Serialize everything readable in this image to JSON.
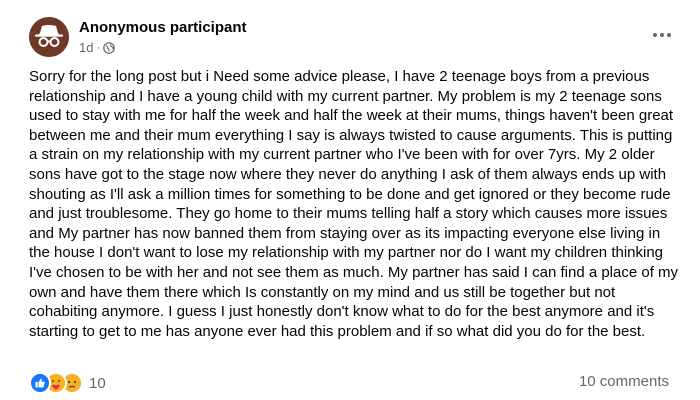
{
  "post": {
    "author": "Anonymous participant",
    "time": "1d",
    "separator": "·",
    "body": "Sorry for the long post but i Need some advice please, I have 2 teenage boys from a previous relationship and I have a young child with my current partner. My problem is my 2 teenage sons used to stay with me for half the week and half the week at their mums, things haven't been great between me and their mum everything I say is always twisted to cause arguments. This is putting a strain on my relationship with my current partner who I've been with for over 7yrs. My 2 older sons have got to the stage now where they never do anything I ask of them always ends up with shouting as I'll ask a million times for something to be done and get ignored or they become rude and just troublesome. They go home to their mums telling half a story which causes more issues and  My partner has now banned them from staying over as its impacting everyone else living in the house I don't want to lose my relationship with my partner nor do I want my children thinking I've chosen to be with her and not see them as much. My partner has said I can find a place of my own and have them there which Is constantly on my mind and us still be together but not cohabiting anymore. I guess I just honestly don't know what to do for the best anymore and it's starting to get to me has anyone ever had this problem and if so what did you do for the best.",
    "reaction_count": "10",
    "comments": "10 comments"
  },
  "icons": {
    "avatar": "anonymous-spy-icon",
    "privacy": "globe-icon",
    "menu": "more-options-icon",
    "reactions": [
      "like-icon",
      "care-icon",
      "sad-icon"
    ]
  },
  "colors": {
    "avatar_bg": "#6e3a27",
    "like_blue": "#1877f2",
    "emoji_yellow": "#f7b125",
    "secondary_text": "#65676b"
  }
}
